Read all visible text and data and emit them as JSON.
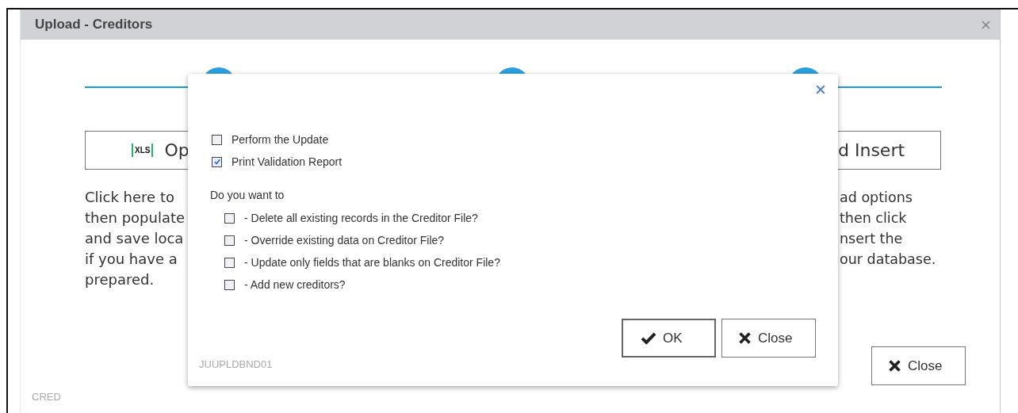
{
  "window": {
    "title": "Upload - Creditors"
  },
  "left_panel": {
    "button": {
      "badge": "XLS",
      "label": "Op"
    },
    "lines": [
      "Click here to",
      "then populate",
      "and save loca",
      "if you have a",
      "prepared."
    ]
  },
  "right_panel": {
    "button": {
      "label": "d Insert"
    },
    "lines": [
      "ad options",
      "then click",
      "nsert the",
      "our database."
    ]
  },
  "footer": {
    "close_button": "Close",
    "code": "CRED"
  },
  "modal": {
    "options": [
      {
        "label": "Perform the Update",
        "checked": false
      },
      {
        "label": "Print Validation Report",
        "checked": true
      }
    ],
    "question": "Do you want to",
    "choices": [
      {
        "label": "- Delete all existing records in the Creditor File?",
        "checked": false
      },
      {
        "label": "- Override existing data on Creditor File?",
        "checked": false
      },
      {
        "label": "- Update only fields that are blanks on Creditor File?",
        "checked": false
      },
      {
        "label": "- Add new creditors?",
        "checked": false
      }
    ],
    "ok_button": "OK",
    "close_button": "Close",
    "code": "JUUPLDBND01"
  }
}
